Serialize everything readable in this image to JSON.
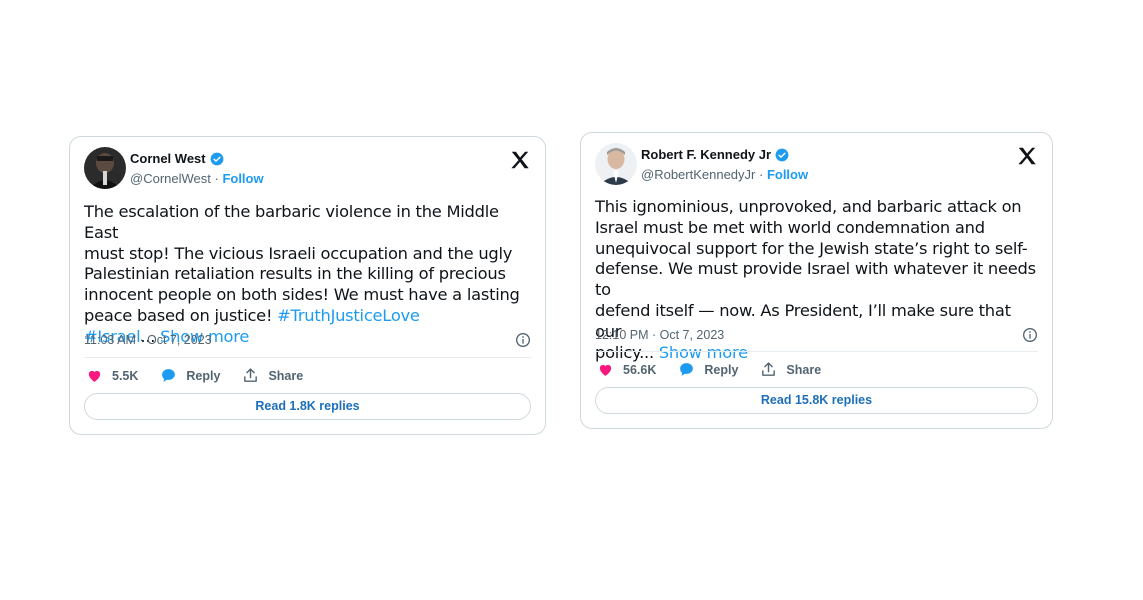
{
  "tweets": [
    {
      "author": "Cornel West",
      "handle": "@CornelWest",
      "sep": " · ",
      "follow": "Follow",
      "text_lines": [
        "The escalation of the barbaric violence in the Middle East",
        "must stop! The vicious Israeli occupation and the ugly",
        "Palestinian retaliation results in the killing of precious",
        "innocent people on both sides! We must have a lasting",
        "peace based on justice! "
      ],
      "hashtag1": "#TruthJusticeLove",
      "hashtag2": "#Israel",
      "ellipsis": "... ",
      "show_more": "Show more",
      "timestamp": "11:03 AM · Oct 7, 2023",
      "likes": "5.5K",
      "reply": "Reply",
      "share": "Share",
      "read_replies": "Read 1.8K replies"
    },
    {
      "author": "Robert F. Kennedy Jr",
      "handle": "@RobertKennedyJr",
      "sep": " · ",
      "follow": "Follow",
      "text_lines": [
        "This ignominious, unprovoked, and barbaric attack on",
        "Israel must be met with world condemnation and",
        "unequivocal support for the Jewish state’s right to self-",
        "defense. We must provide Israel with whatever it needs to",
        "defend itself — now. As President, I’ll make sure that our",
        "policy... "
      ],
      "show_more": "Show more",
      "timestamp": "12:10 PM · Oct 7, 2023",
      "likes": "56.6K",
      "reply": "Reply",
      "share": "Share",
      "read_replies": "Read 15.8K replies"
    }
  ],
  "colors": {
    "accent": "#1d9bf0",
    "like": "#f91880",
    "border": "#cfd9de",
    "muted": "#536471"
  },
  "icons": [
    "verified-badge-icon",
    "x-logo-icon",
    "info-icon",
    "heart-icon",
    "reply-bubble-icon",
    "share-icon"
  ]
}
